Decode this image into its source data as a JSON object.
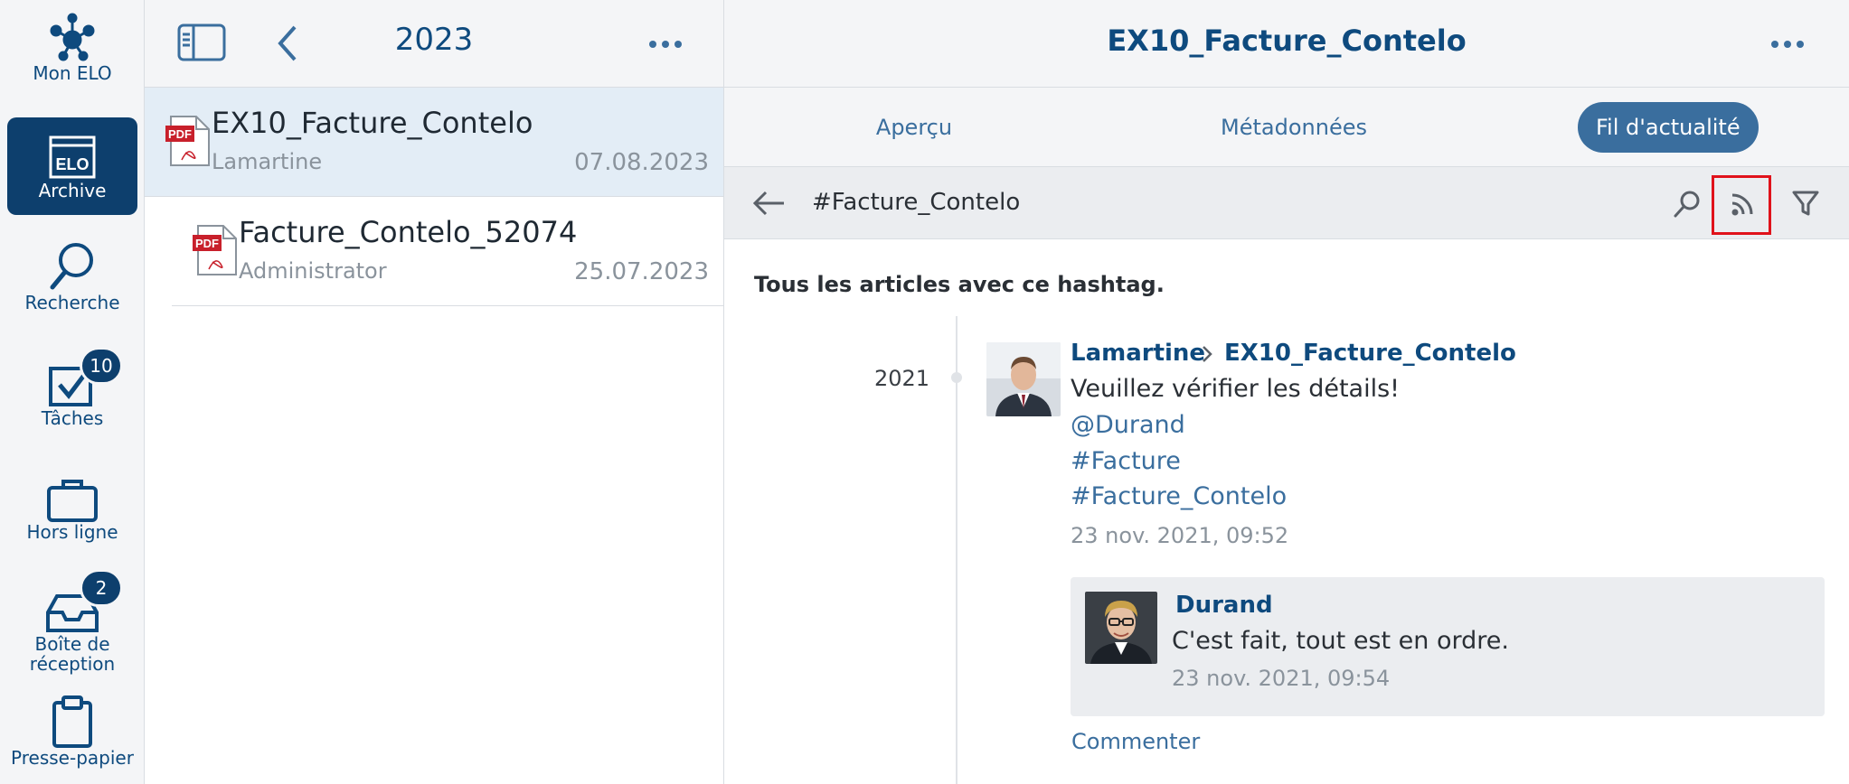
{
  "rail": {
    "items": [
      {
        "label": "Mon ELO",
        "icon": "network-icon"
      },
      {
        "label": "Archive",
        "icon": "elo-archive-icon"
      },
      {
        "label": "Recherche",
        "icon": "search-icon"
      },
      {
        "label": "Tâches",
        "icon": "checkbox-icon",
        "badge": "10"
      },
      {
        "label": "Hors ligne",
        "icon": "briefcase-icon"
      },
      {
        "label": "Boîte de réception",
        "icon": "inbox-icon",
        "badge": "2"
      },
      {
        "label": "Presse-papier",
        "icon": "clipboard-icon"
      }
    ]
  },
  "list": {
    "title": "2023",
    "documents": [
      {
        "name": "EX10_Facture_Contelo",
        "owner": "Lamartine",
        "date": "07.08.2023",
        "type": "PDF"
      },
      {
        "name": "Facture_Contelo_52074",
        "owner": "Administrator",
        "date": "25.07.2023",
        "type": "PDF"
      }
    ]
  },
  "detail": {
    "title": "EX10_Facture_Contelo",
    "tabs": [
      "Aperçu",
      "Métadonnées",
      "Fil d'actualité"
    ],
    "hashtag": "#Facture_Contelo",
    "intro": "Tous les articles avec ce hashtag.",
    "year": "2021",
    "post": {
      "author": "Lamartine",
      "target": "EX10_Facture_Contelo",
      "text": "Veuillez vérifier les détails!",
      "links": [
        "@Durand",
        "#Facture",
        "#Facture_Contelo"
      ],
      "time": "23 nov. 2021, 09:52"
    },
    "reply": {
      "author": "Durand",
      "text": "C'est fait, tout est en ordre.",
      "time": "23 nov. 2021, 09:54"
    },
    "comment_label": "Commenter"
  },
  "colors": {
    "primary": "#0d3f6d",
    "link": "#3a6e9e",
    "highlight": "#e0121b"
  }
}
